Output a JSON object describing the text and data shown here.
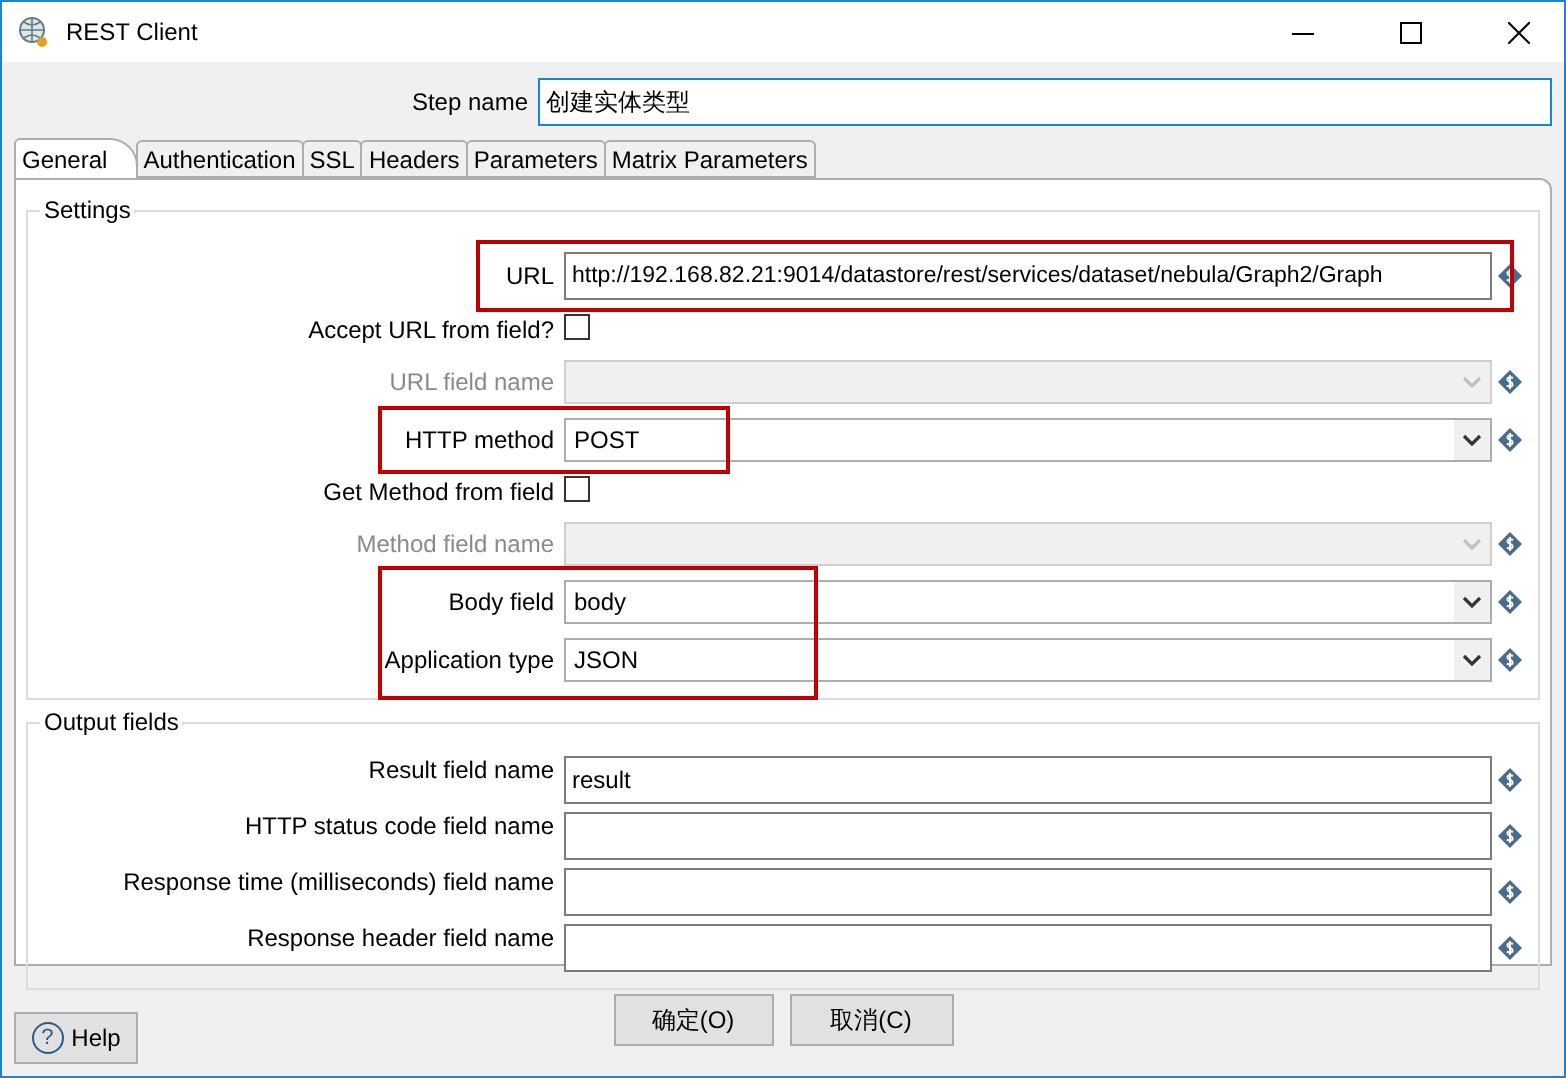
{
  "window": {
    "title": "REST Client"
  },
  "step_name": {
    "label": "Step name",
    "value": "创建实体类型"
  },
  "tabs": [
    {
      "label": "General",
      "selected": true
    },
    {
      "label": "Authentication",
      "selected": false
    },
    {
      "label": "SSL",
      "selected": false
    },
    {
      "label": "Headers",
      "selected": false
    },
    {
      "label": "Parameters",
      "selected": false
    },
    {
      "label": "Matrix Parameters",
      "selected": false
    }
  ],
  "settings": {
    "title": "Settings",
    "rows": [
      {
        "kind": "text",
        "label": "URL",
        "value": "http://192.168.82.21:9014/datastore/rest/services/dataset/nebula/Graph2/Graph",
        "disabled": false,
        "highlighted": true
      },
      {
        "kind": "checkbox",
        "label": "Accept URL from field?",
        "checked": false,
        "highlighted": false
      },
      {
        "kind": "select",
        "label": "URL field name",
        "disabled": true,
        "highlighted": false
      },
      {
        "kind": "select",
        "label": "HTTP method",
        "value": "POST",
        "disabled": false,
        "highlighted": true
      },
      {
        "kind": "checkbox",
        "label": "Get Method from field",
        "checked": false,
        "highlighted": false
      },
      {
        "kind": "select",
        "label": "Method field name",
        "disabled": true,
        "highlighted": false
      },
      {
        "kind": "select",
        "label": "Body field",
        "value": "body",
        "disabled": false,
        "highlighted": true
      },
      {
        "kind": "select",
        "label": "Application type",
        "value": "JSON",
        "disabled": false,
        "highlighted": true
      }
    ]
  },
  "output_fields": {
    "title": "Output fields",
    "rows": [
      {
        "label": "Result field name",
        "value": "result"
      },
      {
        "label": "HTTP status code field name"
      },
      {
        "label": "Response time (milliseconds) field name"
      },
      {
        "label": "Response header field name"
      }
    ]
  },
  "buttons": [
    "确定(O)",
    "取消(C)"
  ],
  "help": {
    "label": "Help",
    "icon_glyph": "?"
  }
}
